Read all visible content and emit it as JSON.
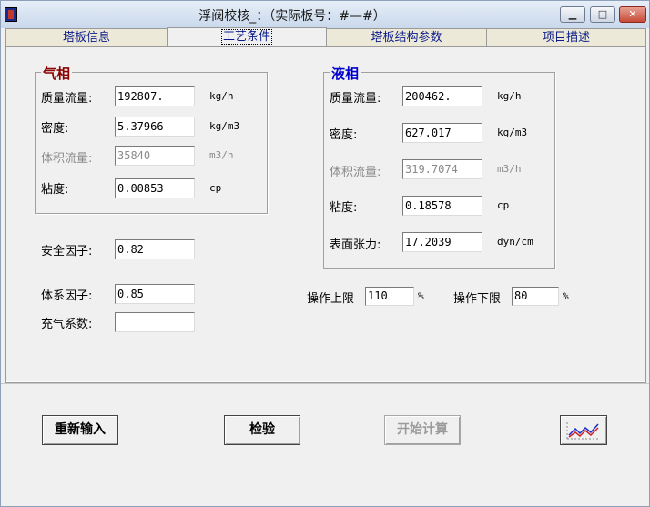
{
  "window": {
    "title": "浮阀校核_：（实际板号：#—#）"
  },
  "tabs": [
    "塔板信息",
    "工艺条件",
    "塔板结构参数",
    "项目描述"
  ],
  "gas": {
    "title": "气相",
    "mass_flow": {
      "label": "质量流量:",
      "value": "192807.",
      "unit": "kg/h"
    },
    "density": {
      "label": "密度:",
      "value": "5.37966",
      "unit": "kg/m3"
    },
    "vol_flow": {
      "label": "体积流量:",
      "value": "35840",
      "unit": "m3/h"
    },
    "viscosity": {
      "label": "粘度:",
      "value": "0.00853",
      "unit": "cp"
    }
  },
  "liquid": {
    "title": "液相",
    "mass_flow": {
      "label": "质量流量:",
      "value": "200462.",
      "unit": "kg/h"
    },
    "density": {
      "label": "密度:",
      "value": "627.017",
      "unit": "kg/m3"
    },
    "vol_flow": {
      "label": "体积流量:",
      "value": "319.7074",
      "unit": "m3/h"
    },
    "viscosity": {
      "label": "粘度:",
      "value": "0.18578",
      "unit": "cp"
    },
    "surface_tension": {
      "label": "表面张力:",
      "value": "17.2039",
      "unit": "dyn/cm"
    }
  },
  "safety_factor": {
    "label": "安全因子:",
    "value": "0.82"
  },
  "system_factor": {
    "label": "体系因子:",
    "value": "0.85"
  },
  "aeration_factor": {
    "label": "充气系数:",
    "value": ""
  },
  "op_upper": {
    "label": "操作上限",
    "value": "110",
    "unit": "%"
  },
  "op_lower": {
    "label": "操作下限",
    "value": "80",
    "unit": "%"
  },
  "buttons": {
    "reset": "重新输入",
    "check": "检验",
    "calc": "开始计算"
  },
  "icons": {
    "chart": "line-chart-icon"
  }
}
